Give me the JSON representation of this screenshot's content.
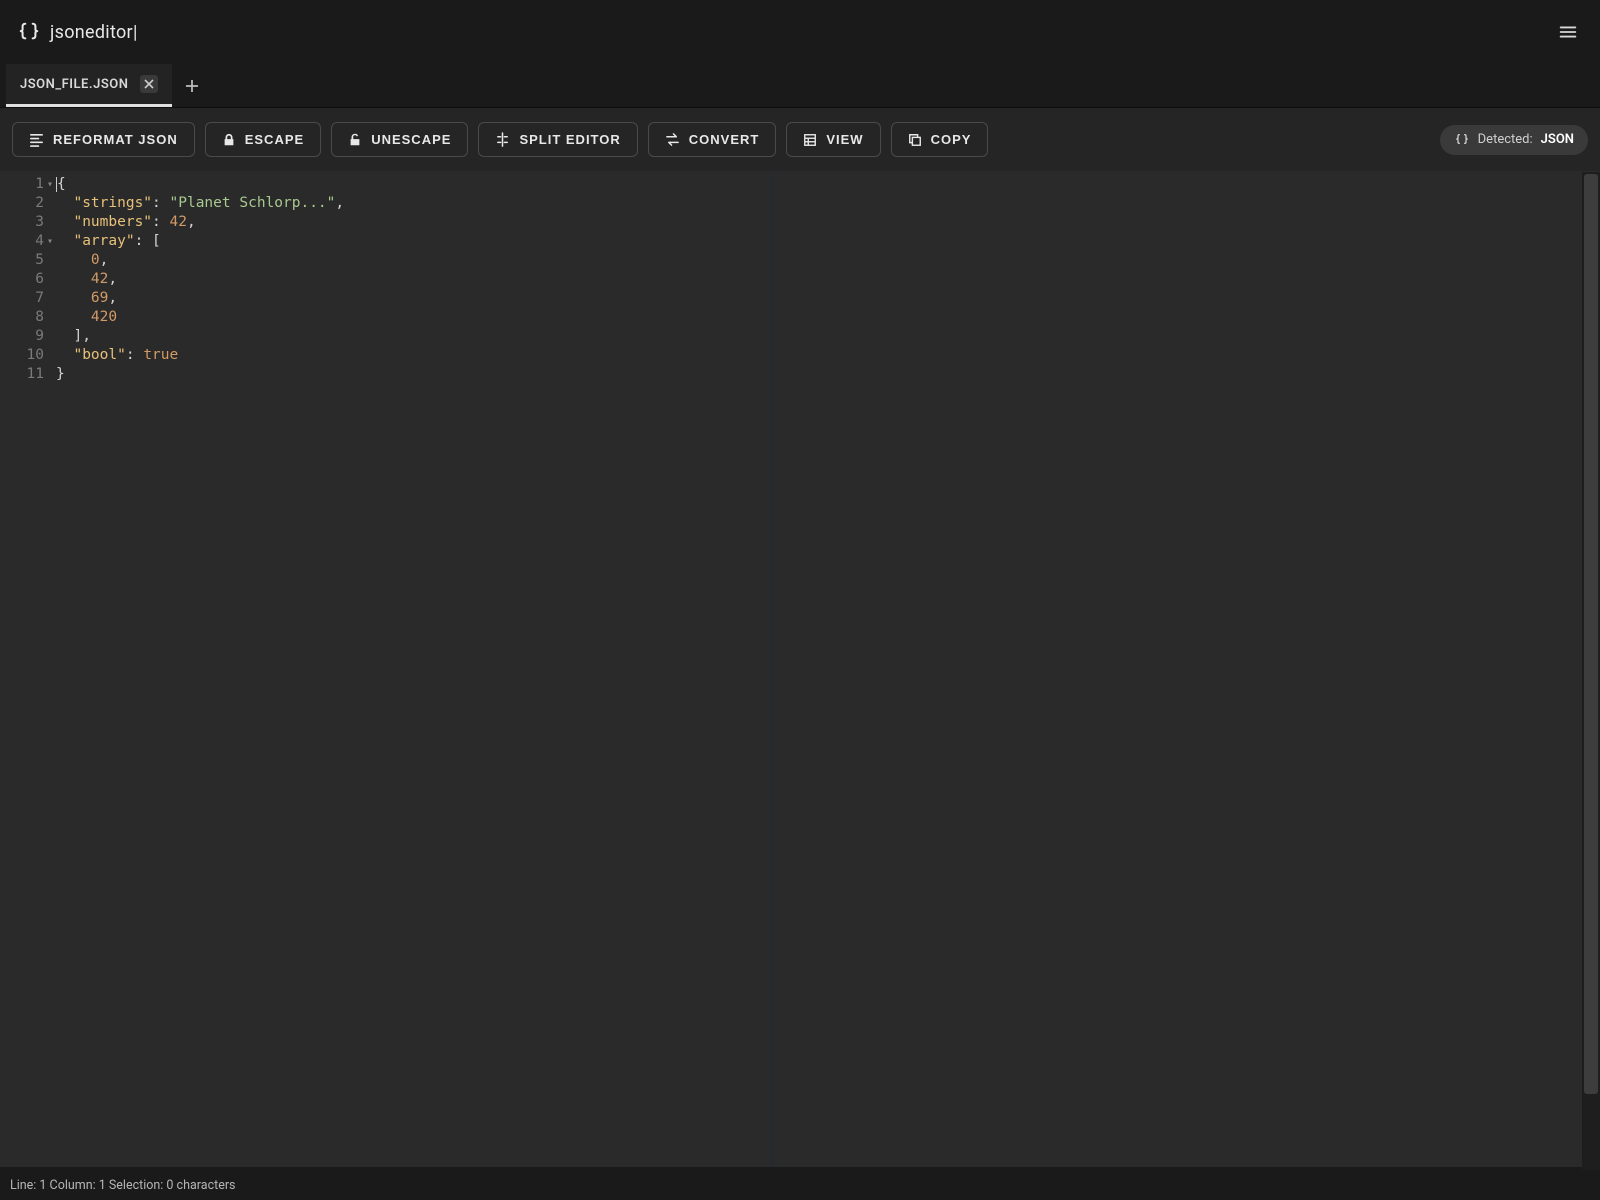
{
  "app": {
    "title": "jsoneditor|"
  },
  "tabs": [
    {
      "label": "JSON_FILE.JSON",
      "active": true
    }
  ],
  "toolbar": {
    "reformat": "REFORMAT JSON",
    "escape": "ESCAPE",
    "unescape": "UNESCAPE",
    "split": "SPLIT EDITOR",
    "convert": "CONVERT",
    "view": "VIEW",
    "copy": "COPY"
  },
  "detected": {
    "prefix": "Detected:",
    "format": "JSON"
  },
  "editor": {
    "lines": [
      {
        "n": "1",
        "fold": true,
        "tokens": [
          {
            "t": "{",
            "c": "punc"
          }
        ]
      },
      {
        "n": "2",
        "tokens": [
          {
            "t": "  ",
            "c": "punc"
          },
          {
            "t": "\"strings\"",
            "c": "key"
          },
          {
            "t": ": ",
            "c": "punc"
          },
          {
            "t": "\"Planet Schlorp...\"",
            "c": "str"
          },
          {
            "t": ",",
            "c": "punc"
          }
        ]
      },
      {
        "n": "3",
        "tokens": [
          {
            "t": "  ",
            "c": "punc"
          },
          {
            "t": "\"numbers\"",
            "c": "key"
          },
          {
            "t": ": ",
            "c": "punc"
          },
          {
            "t": "42",
            "c": "num"
          },
          {
            "t": ",",
            "c": "punc"
          }
        ]
      },
      {
        "n": "4",
        "fold": true,
        "tokens": [
          {
            "t": "  ",
            "c": "punc"
          },
          {
            "t": "\"array\"",
            "c": "key"
          },
          {
            "t": ": [",
            "c": "punc"
          }
        ]
      },
      {
        "n": "5",
        "tokens": [
          {
            "t": "    ",
            "c": "punc"
          },
          {
            "t": "0",
            "c": "num"
          },
          {
            "t": ",",
            "c": "punc"
          }
        ]
      },
      {
        "n": "6",
        "tokens": [
          {
            "t": "    ",
            "c": "punc"
          },
          {
            "t": "42",
            "c": "num"
          },
          {
            "t": ",",
            "c": "punc"
          }
        ]
      },
      {
        "n": "7",
        "tokens": [
          {
            "t": "    ",
            "c": "punc"
          },
          {
            "t": "69",
            "c": "num"
          },
          {
            "t": ",",
            "c": "punc"
          }
        ]
      },
      {
        "n": "8",
        "tokens": [
          {
            "t": "    ",
            "c": "punc"
          },
          {
            "t": "420",
            "c": "num"
          }
        ]
      },
      {
        "n": "9",
        "tokens": [
          {
            "t": "  ],",
            "c": "punc"
          }
        ]
      },
      {
        "n": "10",
        "tokens": [
          {
            "t": "  ",
            "c": "punc"
          },
          {
            "t": "\"bool\"",
            "c": "key"
          },
          {
            "t": ": ",
            "c": "punc"
          },
          {
            "t": "true",
            "c": "bool"
          }
        ]
      },
      {
        "n": "11",
        "tokens": [
          {
            "t": "}",
            "c": "punc"
          }
        ]
      }
    ]
  },
  "status": {
    "text": "Line: 1 Column: 1 Selection: 0 characters"
  }
}
